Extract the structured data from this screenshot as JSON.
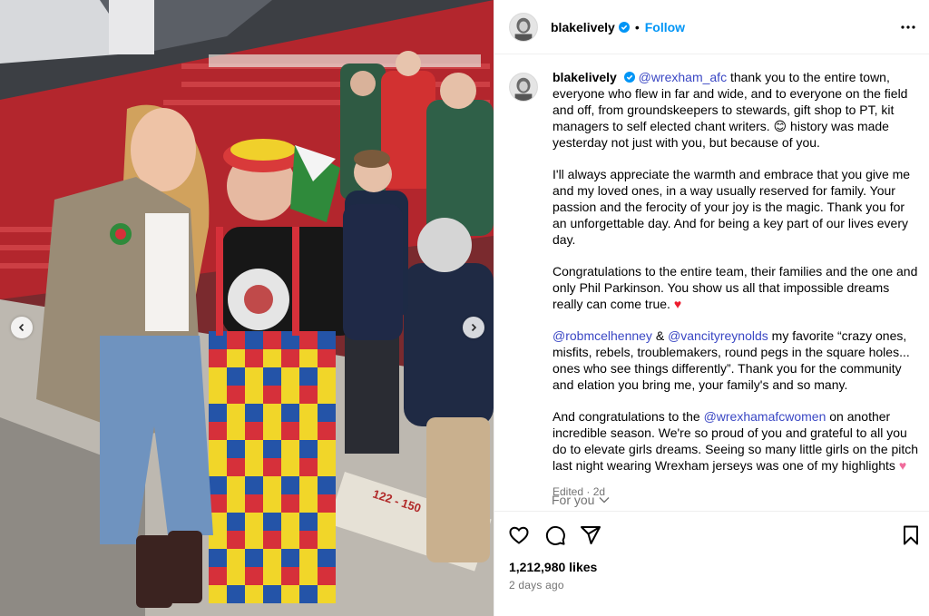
{
  "post": {
    "username": "blakelively",
    "dot": "•",
    "follow_label": "Follow",
    "caption": {
      "username": "blakelively",
      "p1_mention": "@wrexham_afc",
      "p1_text": " thank you to the entire town, everyone who flew in far and wide, and to everyone on the field and off, from groundskeepers to stewards, gift shop to PT, kit managers to self elected chant writers. 😊 history was made yesterday not just with you, but because of you.",
      "p2": "I'll always appreciate the warmth and embrace that you give me and my loved ones, in a way usually reserved for family. Your passion and the ferocity of your joy is the magic. Thank you for an unforgettable day. And for being a key part of our lives every day.",
      "p3": "Congratulations to the entire team, their families and the one and only Phil Parkinson. You show us all that impossible dreams really can come true. ",
      "p3_emoji": "♥",
      "p4_mention1": "@robmcelhenney",
      "p4_amp": " & ",
      "p4_mention2": "@vancityreynolds",
      "p4_text": " my favorite “crazy ones, misfits, rebels, troublemakers, round pegs in the square holes... ones who see things differently”. Thank you for the community and elation you bring me, your family's and so many.",
      "p5_lead": "And congratulations to the ",
      "p5_mention": "@wrexhamafcwomen",
      "p5_text": " on another incredible season. We're so proud of you and grateful to all you do to elevate girls dreams. Seeing so many little girls on the pitch last night wearing Wrexham jerseys was one of my highlights ",
      "p5_emoji": "♥"
    },
    "edited": "Edited · 2d",
    "for_you": "For you",
    "likes": "1,212,980 likes",
    "time_ago": "2 days ago"
  },
  "icons": {
    "verified": "verified-badge-icon",
    "more": "more-options-icon",
    "like": "heart-icon",
    "comment": "comment-icon",
    "share": "share-icon",
    "save": "bookmark-icon",
    "prev": "chevron-left-icon",
    "next": "chevron-right-icon",
    "dropdown": "chevron-down-icon"
  },
  "colors": {
    "link": "#0095f6",
    "mention": "#3a47c4",
    "muted": "#737373",
    "border": "#efefef"
  }
}
